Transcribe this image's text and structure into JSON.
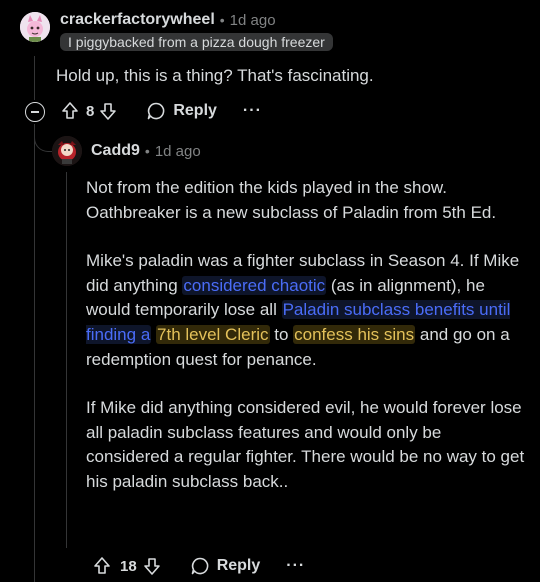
{
  "comment": {
    "username": "crackerfactorywheel",
    "separator": "•",
    "time": "1d ago",
    "flair": "I piggybacked from a pizza dough freezer",
    "body": "Hold up, this is a thing? That's fascinating.",
    "votes": "8",
    "reply_label": "Reply",
    "more_label": "···"
  },
  "reply": {
    "username": "Cadd9",
    "separator": "•",
    "time": "1d ago",
    "p1": "Not from the edition the kids played in the show. Oathbreaker is a new subclass of Paladin from 5th Ed.",
    "p2_a": "Mike's paladin was a fighter subclass in Season 4. If Mike did anything ",
    "p2_link1": "considered chaotic",
    "p2_b": " (as in alignment), he would temporarily lose all ",
    "p2_link2": "Paladin subclass benefits until finding a",
    "p2_c": " ",
    "p2_link3": "7th level Cleric",
    "p2_d": " to ",
    "p2_link4": "confess his sins",
    "p2_e": " and go on a redemption quest for penance.",
    "p3": "If Mike did anything considered evil, he would forever lose all paladin subclass features and would only be considered a regular fighter. There would be no way to get his paladin subclass back..",
    "votes": "18",
    "reply_label": "Reply",
    "more_label": "···"
  },
  "colors": {
    "background": "#000000",
    "text": "#d7dadc",
    "muted": "#818384",
    "link_blue": "#4a6cf7",
    "link_yellow": "#e3c15a"
  }
}
